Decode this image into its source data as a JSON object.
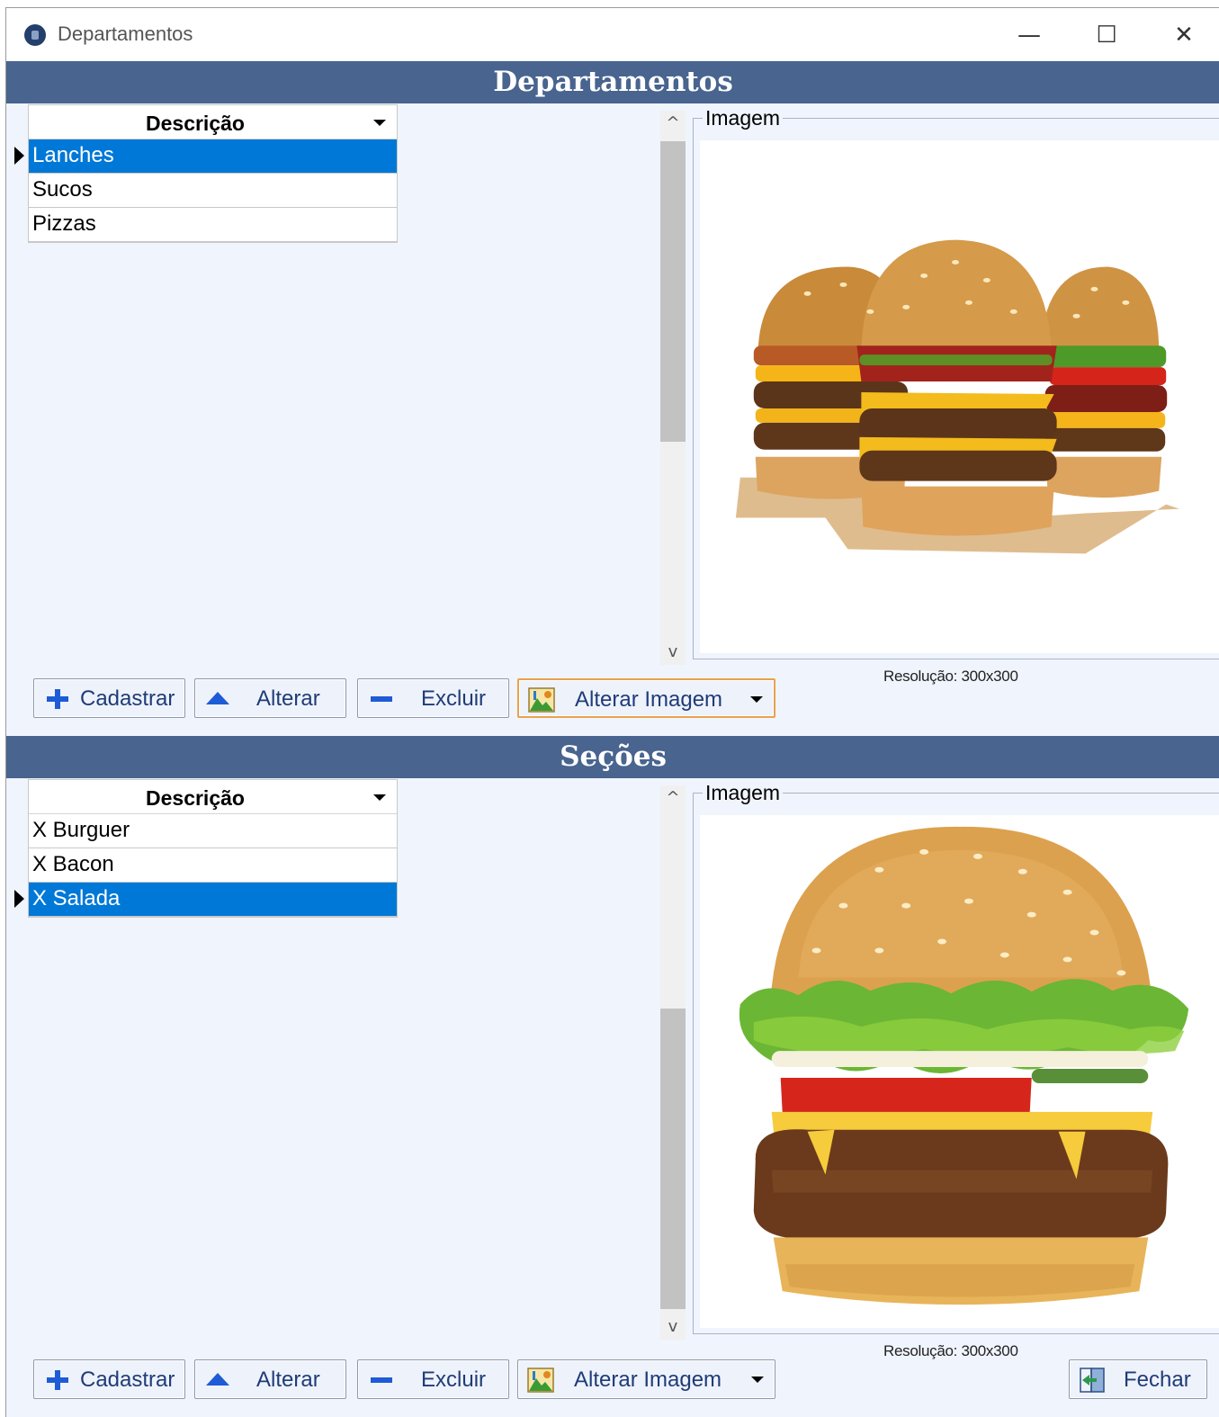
{
  "window": {
    "title": "Departamentos",
    "minimize_glyph": "—",
    "maximize_glyph": "☐",
    "close_glyph": "✕"
  },
  "departamentos": {
    "header": "Departamentos",
    "column": "Descrição",
    "rows": [
      "Lanches",
      "Sucos",
      "Pizzas"
    ],
    "selected_index": 0,
    "image_group_label": "Imagem",
    "image_icon": "burger-trio-image",
    "resolution": "Resolução: 300x300"
  },
  "secoes": {
    "header": "Seções",
    "column": "Descrição",
    "rows": [
      "X Burguer",
      "X Bacon",
      "X Salada"
    ],
    "selected_index": 2,
    "image_group_label": "Imagem",
    "image_icon": "x-salada-image",
    "resolution": "Resolução: 300x300"
  },
  "buttons": {
    "cadastrar": "Cadastrar",
    "alterar": "Alterar",
    "excluir": "Excluir",
    "alterar_imagem": "Alterar Imagem",
    "fechar": "Fechar"
  },
  "scroll": {
    "up_glyph": "^",
    "down_glyph": "v"
  },
  "colors": {
    "header_bg": "#48648f",
    "selection": "#0078d7",
    "button_text": "#1f3c78",
    "accent_border": "#e9a24b"
  }
}
